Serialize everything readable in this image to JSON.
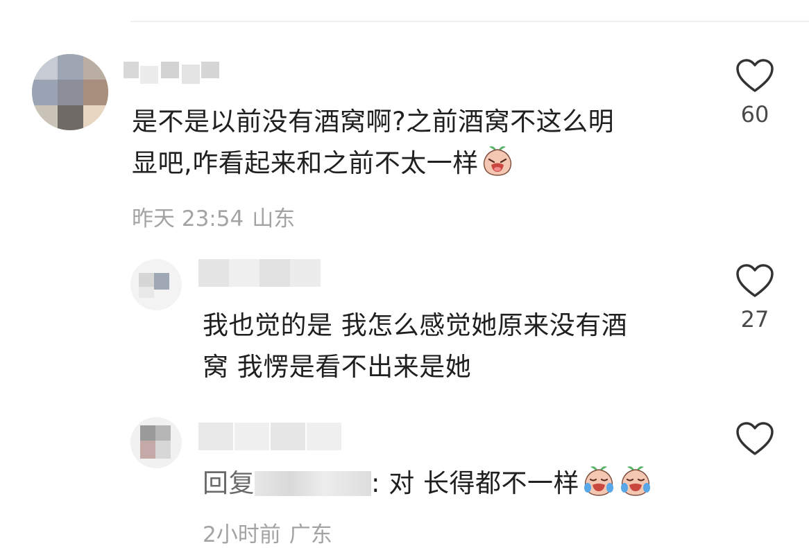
{
  "comments": [
    {
      "text_line1": "是不是以前没有酒窝啊?之前酒窝不这么明",
      "text_line2": "显吧,咋看起来和之前不太一样",
      "emoji": "crying-peach-emoji",
      "time": "昨天 23:54",
      "location": "山东",
      "likes": "60"
    },
    {
      "text_line1": "我也觉的是 我怎么感觉她原来没有酒",
      "text_line2": "窝 我愣是看不出来是她",
      "likes": "27"
    },
    {
      "reply_prefix": "回复",
      "reply_text": ": 对 长得都不一样",
      "emoji": "crying-peach-emoji",
      "time": "2小时前",
      "location": "广东"
    }
  ],
  "icons": {
    "like": "heart-outline-icon"
  },
  "colors": {
    "meta": "#a3a3a3",
    "text": "#1f1f1f",
    "count": "#4a4a4a"
  }
}
